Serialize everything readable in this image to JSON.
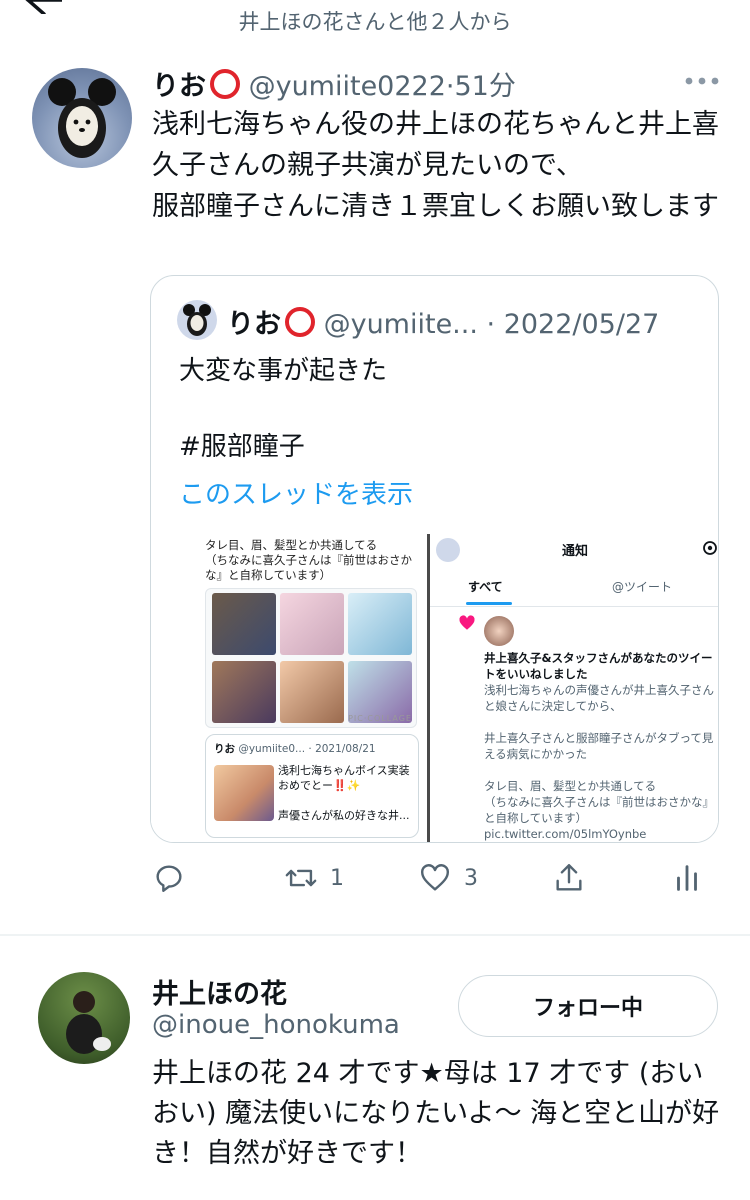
{
  "header": {
    "liked_by": "井上ほの花さんと他２人から"
  },
  "tweet": {
    "author_name": "りお",
    "handle": "@yumiite0222",
    "time": "51分",
    "text": "浅利七海ちゃん役の井上ほの花ちゃんと井上喜久子さんの親子共演が見たいので、\n服部瞳子さんに清き１票宜しくお願い致します",
    "quote": {
      "author_name": "りお",
      "handle": "@yumiite...",
      "date": "2022/05/27",
      "text": "大変な事が起きた\n\n#服部瞳子",
      "show_thread": "このスレッドを表示",
      "media": {
        "left_text": "タレ目、眉、髪型とか共通してる\n（ちなみに喜久子さんは『前世はおさかな』と自称しています）",
        "collage_label": "PIC·COLLAGE",
        "mini_tweet_author": "りお",
        "mini_tweet_handle": "@yumiite0...",
        "mini_tweet_date": "2021/08/21",
        "mini_tweet_text": "浅利七海ちゃんボイス実装おめでとー‼️✨\n\n声優さんが私の好きな井...",
        "notif_title": "通知",
        "notif_tab_all": "すべて",
        "notif_tab_tweets": "@ツイート",
        "notif_liker": "井上喜久子&スタッフ",
        "notif_action": "さんがあなたのツイートをいいねしました",
        "notif_body": "浅利七海ちゃんの声優さんが井上喜久子さんと娘さんに決定してから、\n\n井上喜久子さんと服部瞳子さんがタブって見える病気にかかった\n\nタレ目、眉、髪型とか共通してる\n（ちなみに喜久子さんは『前世はおさかな』と自称しています） pic.twitter.com/05lmYOynbe"
      }
    },
    "actions": {
      "retweet_count": "1",
      "like_count": "3"
    }
  },
  "profile": {
    "name": "井上ほの花",
    "handle": "@inoue_honokuma",
    "follow_label": "フォロー中",
    "bio": "井上ほの花 24 才です★母は 17 才です (おいおい) 魔法使いになりたいよ〜 海と空と山が好き！自然が好きです！"
  },
  "colors": {
    "accent": "#1d9bf0",
    "text_secondary": "#536471",
    "border": "#cfd9de",
    "record_emoji": "#e0242c"
  }
}
